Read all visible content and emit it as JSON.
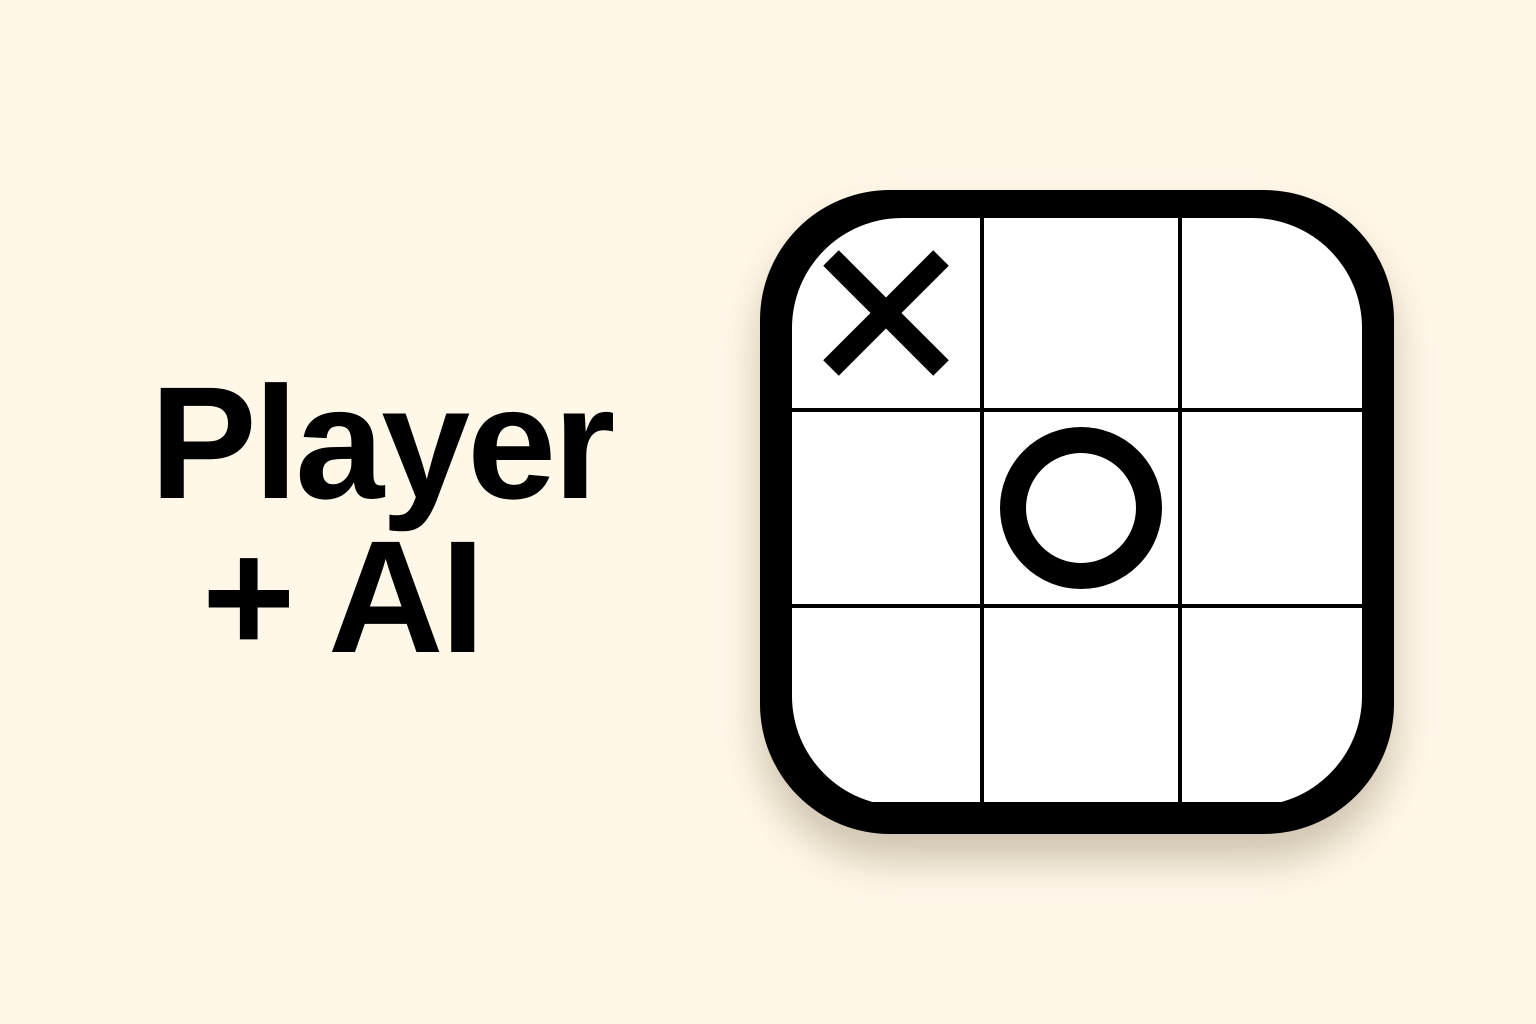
{
  "title": {
    "line1": "Player",
    "line2": "+ AI"
  },
  "colors": {
    "background": "#FFF7E8",
    "board": "#FFFFFF",
    "ink": "#000000"
  },
  "board": {
    "cells": [
      "X",
      "",
      "",
      "",
      "O",
      "",
      "",
      "",
      ""
    ]
  }
}
